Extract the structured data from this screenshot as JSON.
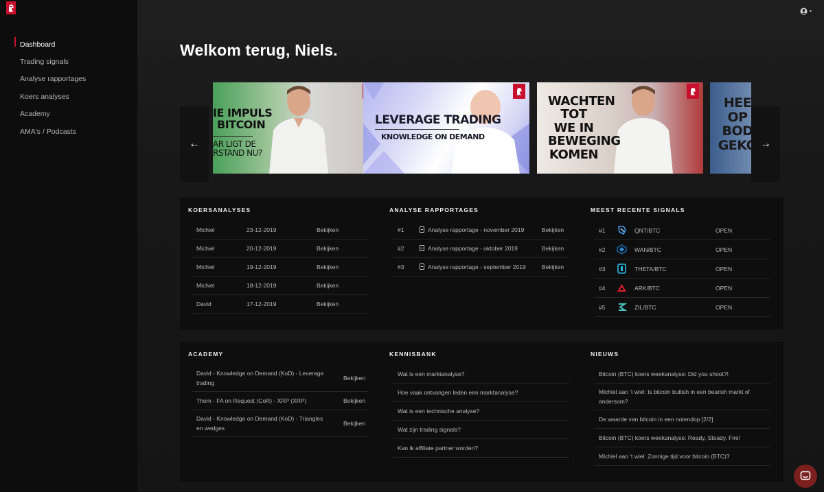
{
  "brand": {
    "logo_icon": "knight-helmet-icon",
    "accent": "#c8102e"
  },
  "sidebar": {
    "items": [
      {
        "label": "Dashboard",
        "active": true
      },
      {
        "label": "Trading signals"
      },
      {
        "label": "Analyse rapportages"
      },
      {
        "label": "Koers analyses"
      },
      {
        "label": "Academy"
      },
      {
        "label": "AMA's / Podcasts"
      }
    ]
  },
  "header": {
    "user_icon": "user-circle-icon",
    "caret": "▾"
  },
  "welcome": "Welkom terug, Niels.",
  "carousel": {
    "prev_icon": "arrow-left-icon",
    "next_icon": "arrow-right-icon",
    "cards": [
      {
        "lines": [
          "IE IMPULS",
          "BITCOIN",
          "AR LIGT DE",
          "RSTAND NU?"
        ]
      },
      {
        "lines": [
          "LEVERAGE TRADING",
          "KNOWLEDGE ON DEMAND"
        ]
      },
      {
        "lines": [
          "WACHTEN",
          "TOT WE IN",
          "BEWEGING",
          "KOMEN"
        ]
      },
      {
        "lines": [
          "HEE",
          "OP",
          "BOD",
          "GEKO"
        ]
      }
    ]
  },
  "koersanalyses": {
    "title": "KOERSANALYSES",
    "rows": [
      {
        "author": "Michiel",
        "date": "23-12-2019",
        "action": "Bekijken"
      },
      {
        "author": "Michiel",
        "date": "20-12-2019",
        "action": "Bekijken"
      },
      {
        "author": "Michiel",
        "date": "19-12-2019",
        "action": "Bekijken"
      },
      {
        "author": "Michiel",
        "date": "18-12-2019",
        "action": "Bekijken"
      },
      {
        "author": "David",
        "date": "17-12-2019",
        "action": "Bekijken"
      }
    ]
  },
  "rapportages": {
    "title": "ANALYSE RAPPORTAGES",
    "rows": [
      {
        "rank": "#1",
        "name": "Analyse rapportage - november 2019",
        "action": "Bekijken"
      },
      {
        "rank": "#2",
        "name": "Analyse rapportage - oktober 2019",
        "action": "Bekijken"
      },
      {
        "rank": "#3",
        "name": "Analyse rapportage - september 2019",
        "action": "Bekijken"
      }
    ]
  },
  "signals": {
    "title": "MEEST RECENTE SIGNALS",
    "rows": [
      {
        "rank": "#1",
        "pair": "QNT/BTC",
        "status": "OPEN",
        "icon": "qnt-icon",
        "color": "#4b9cf0"
      },
      {
        "rank": "#2",
        "pair": "WAN/BTC",
        "status": "OPEN",
        "icon": "wan-icon",
        "color": "#1a6fb5"
      },
      {
        "rank": "#3",
        "pair": "THETA/BTC",
        "status": "OPEN",
        "icon": "theta-icon",
        "color": "#2ab8e6"
      },
      {
        "rank": "#4",
        "pair": "ARK/BTC",
        "status": "OPEN",
        "icon": "ark-icon",
        "color": "#e01e2e"
      },
      {
        "rank": "#5",
        "pair": "ZIL/BTC",
        "status": "OPEN",
        "icon": "zil-icon",
        "color": "#49c1bf"
      }
    ]
  },
  "academy": {
    "title": "ACADEMY",
    "rows": [
      {
        "name": "David - Knowledge on Demand (KoD) - Leverage trading",
        "action": "Bekijken"
      },
      {
        "name": "Thom - FA on Request (CoR) - XRP (XRP)",
        "action": "Bekijken"
      },
      {
        "name": "David - Knowledge on Demand (KoD) - Triangles en wedges",
        "action": "Bekijken"
      }
    ]
  },
  "kennisbank": {
    "title": "KENNISBANK",
    "rows": [
      "Wat is een marktanalyse?",
      "Hoe vaak ontvangen leden een marktanalyse?",
      "Wat is een technische analyse?",
      "Wat zijn trading signals?",
      "Kan ik affiliate partner worden?"
    ]
  },
  "nieuws": {
    "title": "NIEUWS",
    "rows": [
      "Bitcoin (BTC) koers weekanalyse: Did you shoot?!",
      "Michiel aan 't wiel: Is bitcoin bullish in een bearish markt of andersom?",
      "De waarde van bitcoin in een notendop [2/2]",
      "Bitcoin (BTC) koers weekanalyse: Ready, Steady, Fire!",
      "Michiel aan 't wiel: Zonnige tijd voor bitcoin (BTC)?"
    ]
  },
  "chat": {
    "icon": "chat-bubble-icon"
  }
}
